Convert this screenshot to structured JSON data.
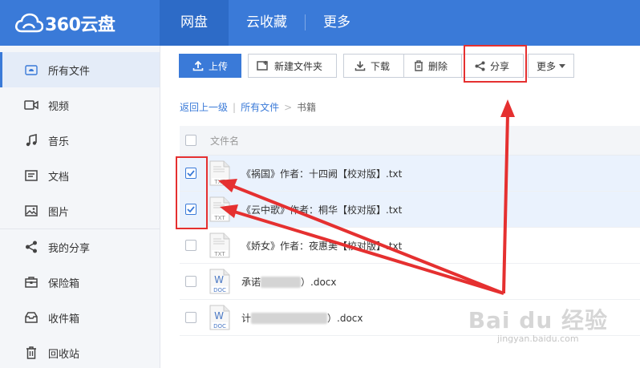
{
  "header": {
    "logo_text": "360云盘",
    "nav": [
      "网盘",
      "云收藏",
      "更多"
    ],
    "active_index": 0,
    "brand_color": "#3a7ad8"
  },
  "sidebar": {
    "items": [
      {
        "label": "所有文件",
        "icon": "cloud-icon"
      },
      {
        "label": "视频",
        "icon": "video-icon"
      },
      {
        "label": "音乐",
        "icon": "music-icon"
      },
      {
        "label": "文档",
        "icon": "document-icon"
      },
      {
        "label": "图片",
        "icon": "image-icon"
      },
      {
        "label": "我的分享",
        "icon": "share-icon"
      },
      {
        "label": "保险箱",
        "icon": "safe-icon"
      },
      {
        "label": "收件箱",
        "icon": "inbox-icon"
      },
      {
        "label": "回收站",
        "icon": "trash-icon"
      }
    ]
  },
  "toolbar": {
    "upload": "上传",
    "new_folder": "新建文件夹",
    "download": "下载",
    "delete": "删除",
    "share": "分享",
    "more": "更多"
  },
  "breadcrumb": {
    "back": "返回上一级",
    "separator": "|",
    "root": "所有文件",
    "arrow": ">",
    "current": "书籍"
  },
  "table": {
    "header": "文件名",
    "files": [
      {
        "name": "《祸国》作者：十四阙【校对版】.txt",
        "type": "TXT",
        "checked": true
      },
      {
        "name": "《云中歌》作者：桐华【校对版】.txt",
        "type": "TXT",
        "checked": true
      },
      {
        "name": "《娇女》作者：夜惠美【校对版】.txt",
        "type": "TXT",
        "checked": false
      },
      {
        "name_prefix": "承诺",
        "name_suffix": "）.docx",
        "type": "DOC",
        "checked": false
      },
      {
        "name_prefix": "计",
        "name_suffix": "）.docx",
        "type": "DOC",
        "checked": false
      }
    ]
  },
  "watermark": {
    "main": "Bai du 经验",
    "sub": "jingyan.baidu.com"
  },
  "colors": {
    "annotation_red": "#e53030",
    "selected_row": "#eaf2fd"
  }
}
